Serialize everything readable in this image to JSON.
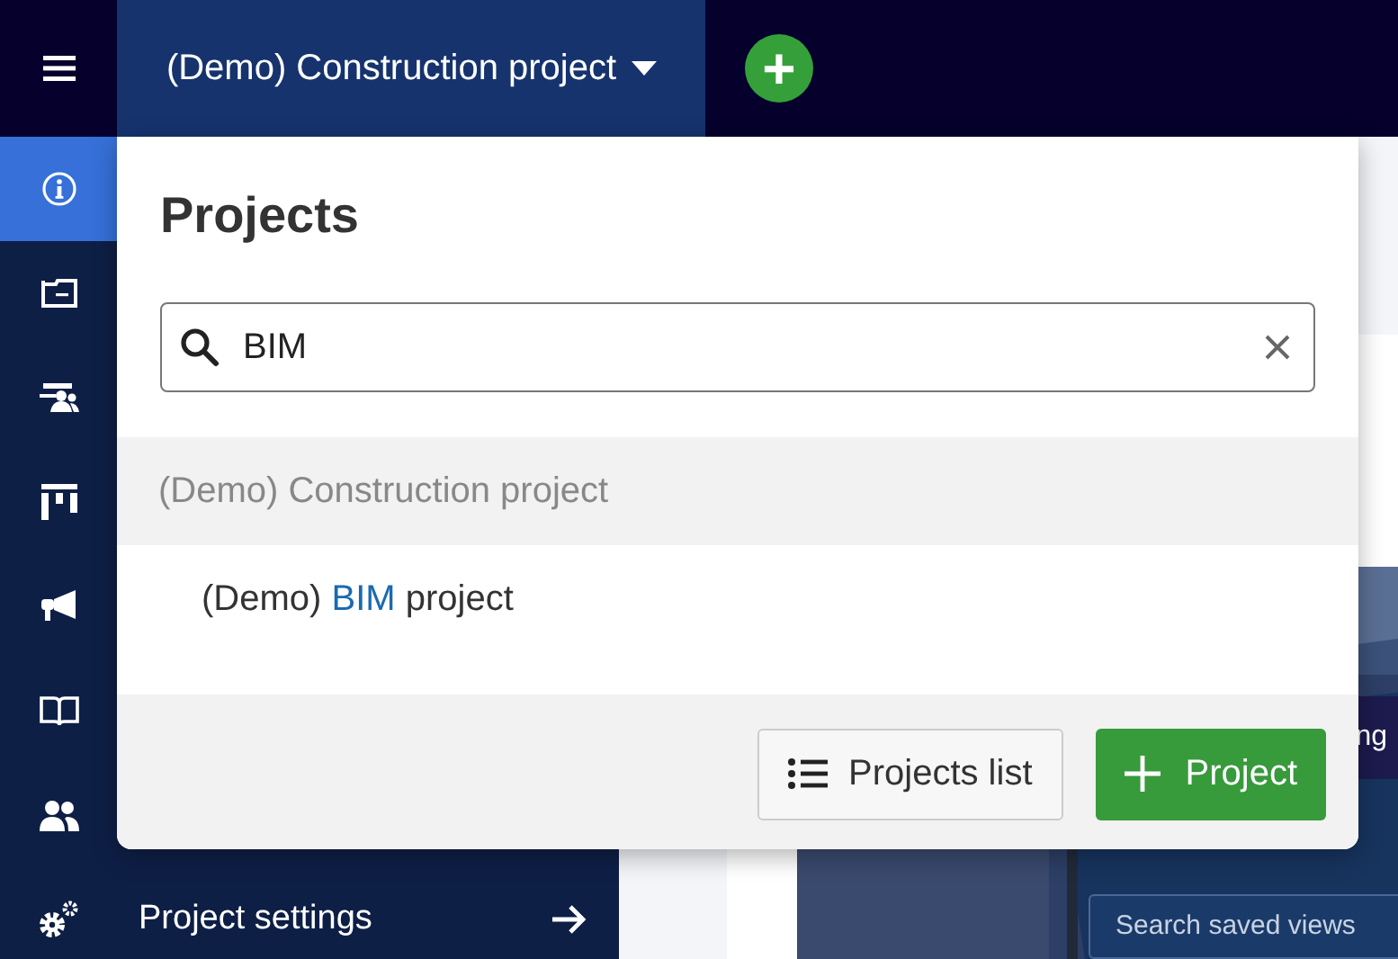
{
  "top_bar": {
    "project_name": "(Demo) Construction project",
    "add_button": "+"
  },
  "sidebar": {
    "items": [
      {
        "kind": "info",
        "selected": true
      },
      {
        "kind": "folder",
        "selected": false
      },
      {
        "kind": "meeting",
        "selected": false
      },
      {
        "kind": "board",
        "selected": false
      },
      {
        "kind": "megaphone",
        "selected": false
      },
      {
        "kind": "book",
        "selected": false
      },
      {
        "kind": "people",
        "selected": false
      },
      {
        "kind": "gears",
        "label": "Project settings",
        "selected": false
      }
    ]
  },
  "preview": {
    "banner_text": "ng",
    "search": {
      "placeholder": "Search saved views"
    }
  },
  "popup": {
    "title": "Projects",
    "search": {
      "value": "BIM"
    },
    "projects": [
      {
        "parts": [
          {
            "text": "(Demo) Construction project",
            "match": false
          }
        ],
        "current": true,
        "children": [
          {
            "parts": [
              {
                "text": "(Demo) ",
                "match": false
              },
              {
                "text": "BIM",
                "match": true
              },
              {
                "text": " project",
                "match": false
              }
            ],
            "current": false
          }
        ]
      }
    ],
    "buttons": [
      {
        "kind": "list",
        "label": "Projects list"
      },
      {
        "kind": "add",
        "label": "Project"
      }
    ]
  }
}
